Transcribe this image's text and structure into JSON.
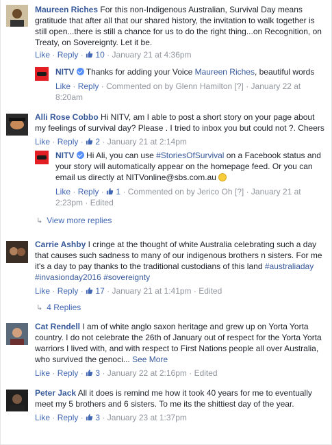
{
  "comments": [
    {
      "name": "Maureen Riches",
      "text": "For this non-Indigenous Australian, Survival Day means gratitude that after all that our shared history, the invitation to walk together is still open...there is still a chance for us to do the right thing...on Recognition, on Treaty, on Sovereignty. Let it be.",
      "like": "Like",
      "reply": "Reply",
      "likes": "10",
      "time": "January 21 at 4:36pm"
    },
    {
      "name": "Alli Rose Cobbo",
      "text": "Hi NITV, am I able to post a short story on your page about my feelings of survival day? Please . I tried to inbox you but could not ?. Cheers",
      "like": "Like",
      "reply": "Reply",
      "likes": "2",
      "time": "January 21 at 2:14pm"
    },
    {
      "name": "Carrie Ashby",
      "text": "I cringe at the thought of white Australia celebrating such a day that causes such sadness to many of our indigenous brothers n sisters. For me it's a day to pay thanks to the traditional custodians of this land",
      "hashtags": "#australiaday #invasionday2016 #sovereignty",
      "like": "Like",
      "reply": "Reply",
      "likes": "17",
      "time": "January 21 at 1:41pm",
      "edited": "Edited",
      "replies_link": "4 Replies"
    },
    {
      "name": "Cat Rendell",
      "text": "I am of white anglo saxon heritage and grew up on Yorta Yorta country. I do not celebrate the 26th of January out of respect for the Yorta Yorta warriors I lived with, and with respect to First Nations people all over Australia, who survived the genoci...",
      "see_more": "See More",
      "like": "Like",
      "reply": "Reply",
      "likes": "3",
      "time": "January 22 at 2:16pm",
      "edited": "Edited"
    },
    {
      "name": "Peter Jack",
      "text": "All it does is remind me how it took 40 years for me to eventually meet my 5 brothers and 6 sisters. To me its the shittiest day of the year.",
      "like": "Like",
      "reply": "Reply",
      "likes": "3",
      "time": "January 23 at 1:37pm"
    }
  ],
  "reply1": {
    "name": "NITV",
    "text_pre": "Thanks for adding your Voice ",
    "mention": "Maureen Riches",
    "text_post": ", beautiful words",
    "like": "Like",
    "reply": "Reply",
    "commented_on_by": "Commented on by Glenn Hamilton",
    "help": "[?]",
    "time": "January 22 at 8:20am"
  },
  "reply2": {
    "name": "NITV",
    "text_pre": "Hi Ali, you can use ",
    "hashtag": "#StoriesOfSurvival",
    "text_post": " on a Facebook status and your story will automatically appear on the homepage feed. Or you can email us directly at NITVonline@sbs.com.au",
    "like": "Like",
    "reply": "Reply",
    "likes": "1",
    "commented_on_by": "Commented on by Jerico Oh",
    "help": "[?]",
    "time": "January 21 at 2:23pm",
    "edited": "Edited"
  },
  "view_more_replies": "View more replies",
  "colors": {
    "link": "#365899",
    "action": "#4267b2",
    "meta": "#90949c",
    "brand_red": "#e31e24",
    "verified": "#5890ff"
  }
}
